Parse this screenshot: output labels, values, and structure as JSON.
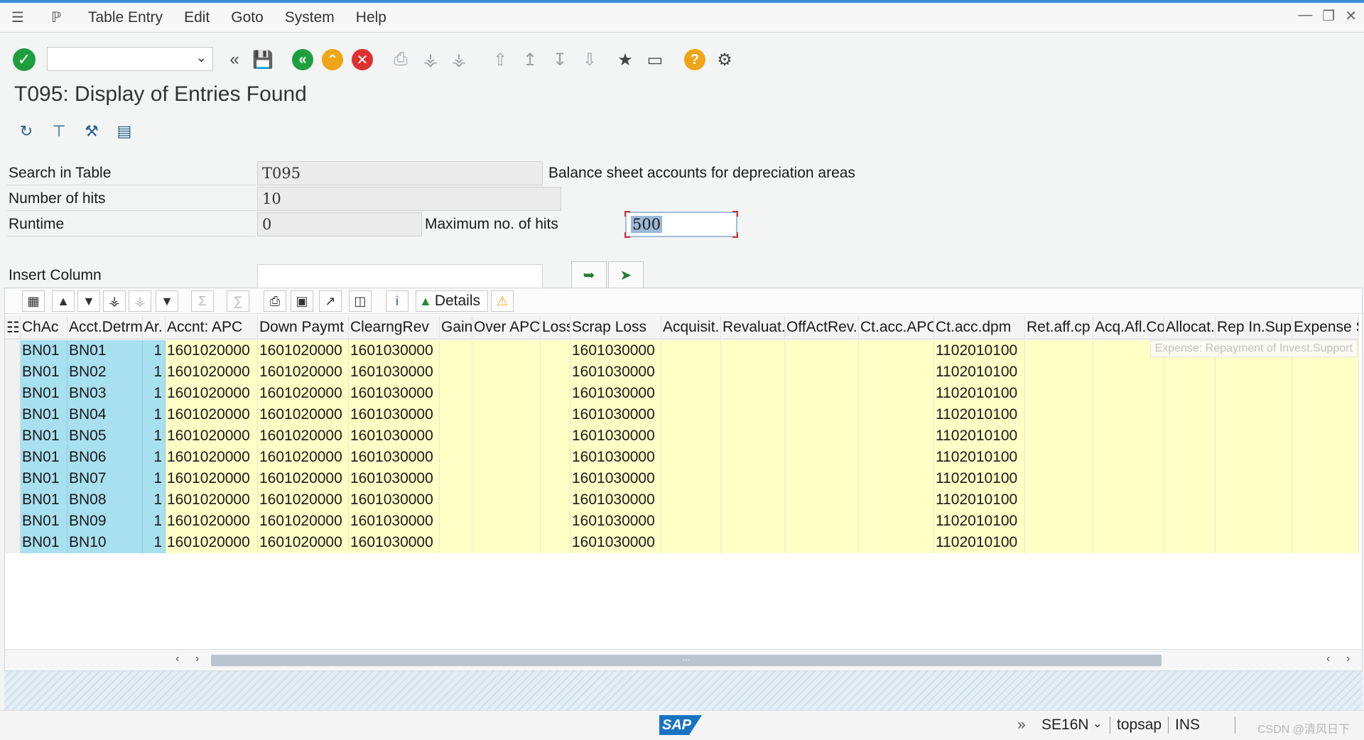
{
  "menu": {
    "items": [
      "Table Entry",
      "Edit",
      "Goto",
      "System",
      "Help"
    ]
  },
  "toolbar": {
    "command_value": ""
  },
  "page": {
    "title": "T095: Display of Entries Found"
  },
  "form": {
    "search_label": "Search in Table",
    "search_value": "T095",
    "search_desc": "Balance sheet accounts for depreciation areas",
    "hits_label": "Number of hits",
    "hits_value": "10",
    "runtime_label": "Runtime",
    "runtime_value": "0",
    "max_label": "Maximum no. of hits",
    "max_value": "500",
    "insert_label": "Insert Column"
  },
  "grid": {
    "details_label": "Details",
    "tooltip": "Expense: Repayment of Invest.Support",
    "columns": [
      "ChAc",
      "Acct.Detrm",
      "Ar.",
      "Accnt: APC",
      "Down Paymt",
      "ClearngRev",
      "Gain",
      "Over APC",
      "Loss",
      "Scrap Loss",
      "Acquisit.",
      "Revaluat.",
      "OffActRev.",
      "Ct.acc.APC",
      "Ct.acc.dpm",
      "Ret.aff.cp",
      "Acq.Afl.Co",
      "Allocat.",
      "Rep In.Sup",
      "Expense S"
    ],
    "rows": [
      [
        "BN01",
        "BN01",
        "1",
        "1601020000",
        "1601020000",
        "1601030000",
        "",
        "",
        "",
        "1601030000",
        "",
        "",
        "",
        "",
        "1102010100",
        "",
        "",
        "",
        "",
        ""
      ],
      [
        "BN01",
        "BN02",
        "1",
        "1601020000",
        "1601020000",
        "1601030000",
        "",
        "",
        "",
        "1601030000",
        "",
        "",
        "",
        "",
        "1102010100",
        "",
        "",
        "",
        "",
        ""
      ],
      [
        "BN01",
        "BN03",
        "1",
        "1601020000",
        "1601020000",
        "1601030000",
        "",
        "",
        "",
        "1601030000",
        "",
        "",
        "",
        "",
        "1102010100",
        "",
        "",
        "",
        "",
        ""
      ],
      [
        "BN01",
        "BN04",
        "1",
        "1601020000",
        "1601020000",
        "1601030000",
        "",
        "",
        "",
        "1601030000",
        "",
        "",
        "",
        "",
        "1102010100",
        "",
        "",
        "",
        "",
        ""
      ],
      [
        "BN01",
        "BN05",
        "1",
        "1601020000",
        "1601020000",
        "1601030000",
        "",
        "",
        "",
        "1601030000",
        "",
        "",
        "",
        "",
        "1102010100",
        "",
        "",
        "",
        "",
        ""
      ],
      [
        "BN01",
        "BN06",
        "1",
        "1601020000",
        "1601020000",
        "1601030000",
        "",
        "",
        "",
        "1601030000",
        "",
        "",
        "",
        "",
        "1102010100",
        "",
        "",
        "",
        "",
        ""
      ],
      [
        "BN01",
        "BN07",
        "1",
        "1601020000",
        "1601020000",
        "1601030000",
        "",
        "",
        "",
        "1601030000",
        "",
        "",
        "",
        "",
        "1102010100",
        "",
        "",
        "",
        "",
        ""
      ],
      [
        "BN01",
        "BN08",
        "1",
        "1601020000",
        "1601020000",
        "1601030000",
        "",
        "",
        "",
        "1601030000",
        "",
        "",
        "",
        "",
        "1102010100",
        "",
        "",
        "",
        "",
        ""
      ],
      [
        "BN01",
        "BN09",
        "1",
        "1601020000",
        "1601020000",
        "1601030000",
        "",
        "",
        "",
        "1601030000",
        "",
        "",
        "",
        "",
        "1102010100",
        "",
        "",
        "",
        "",
        ""
      ],
      [
        "BN01",
        "BN10",
        "1",
        "1601020000",
        "1601020000",
        "1601030000",
        "",
        "",
        "",
        "1601030000",
        "",
        "",
        "",
        "",
        "1102010100",
        "",
        "",
        "",
        "",
        ""
      ]
    ]
  },
  "status": {
    "logo": "SAP",
    "transaction": "SE16N",
    "server": "topsap",
    "mode": "INS",
    "watermark": "CSDN @清风日下"
  },
  "colors": {
    "accent": "#1f9e3e",
    "key_cell": "#a8e0f0",
    "data_cell": "#ffffc6"
  }
}
